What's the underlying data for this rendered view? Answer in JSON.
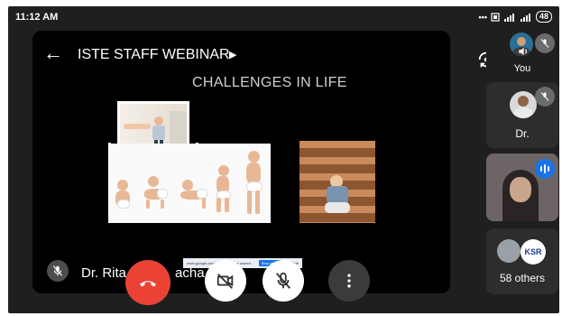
{
  "statusbar": {
    "time": "11:12 AM",
    "battery": "48",
    "icons": [
      "more-dots-icon",
      "data-icon",
      "signal-icon",
      "signal-icon",
      "battery-icon"
    ]
  },
  "meeting": {
    "title": "ISTE STAFF WEBINAR",
    "slide_heading": "CHALLENGES IN LIFE",
    "presenter_name": "Dr. Rita",
    "presenter_name_tail": "acha",
    "share_banner_text": "meet.google.com is sharing your screen.",
    "share_stop_label": "Stop sharing",
    "share_hide_label": "Hide"
  },
  "participants": [
    {
      "label": "You",
      "muted": true
    },
    {
      "label": "Dr.",
      "muted": true
    },
    {
      "label": "",
      "speaking": true
    },
    {
      "label": "58 others",
      "logo_text": "KSR"
    }
  ],
  "controls": {
    "end_call": "phone-hangup-icon",
    "camera": "camera-off-icon",
    "mic": "mic-off-icon",
    "more": "more-vert-icon"
  },
  "colors": {
    "end_call_red": "#ea4335",
    "speaking_blue": "#1a73e8",
    "background": "#1f1f1f",
    "stage": "#000000"
  }
}
